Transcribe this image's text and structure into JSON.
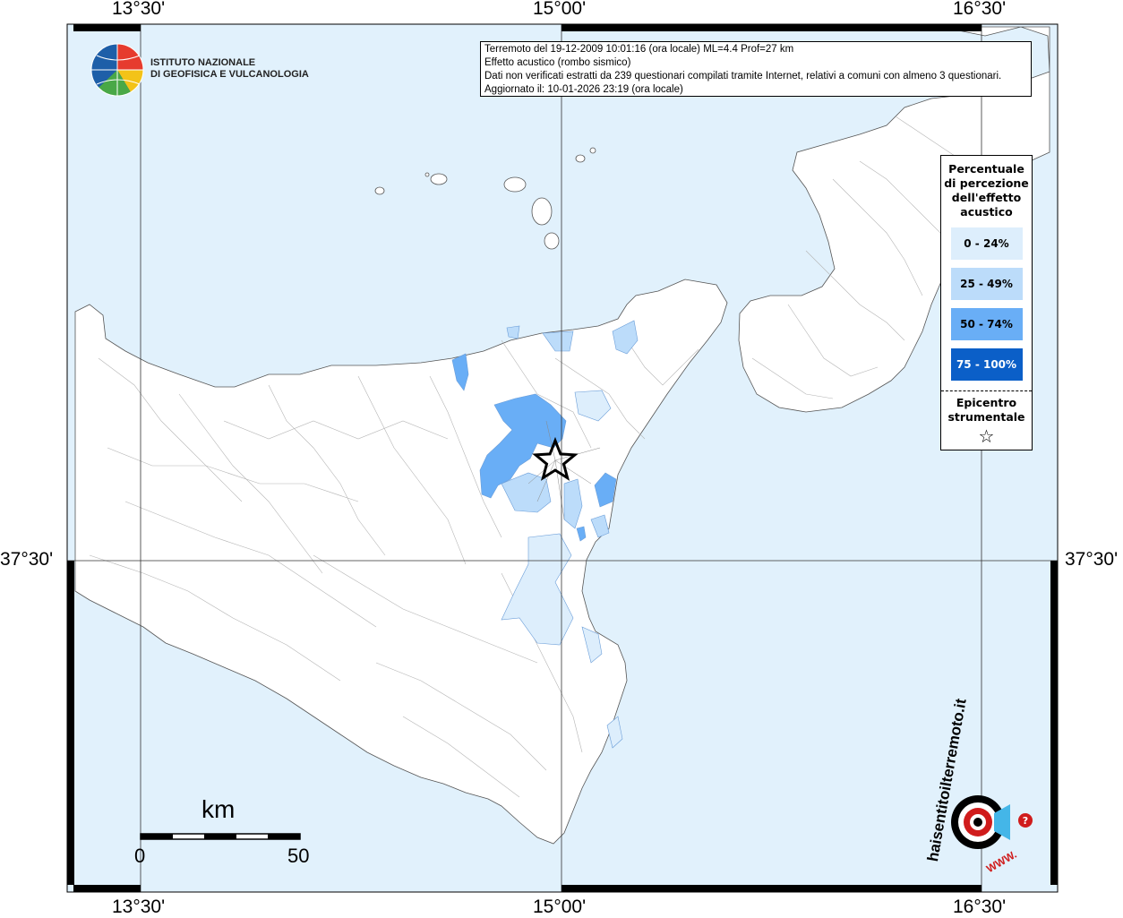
{
  "map": {
    "longitude_labels": [
      "13°30'",
      "15°00'",
      "16°30'"
    ],
    "latitude_labels": [
      "37°30'",
      "37°30'"
    ]
  },
  "info": {
    "line1": "Terremoto del 19-12-2009 10:01:16 (ora locale) ML=4.4 Prof=27 km",
    "line2": "Effetto acustico (rombo sismico)",
    "line3": "Dati non verificati estratti da 239 questionari compilati tramite Internet, relativi a comuni con almeno 3 questionari.",
    "line4": "Aggiornato il: 10-01-2026 23:19 (ora locale)"
  },
  "legend": {
    "title": "Percentuale di percezione dell'effetto acustico",
    "items": [
      {
        "label": "0 - 24%",
        "color": "#ddeefc"
      },
      {
        "label": "25 - 49%",
        "color": "#bcdcfa"
      },
      {
        "label": "50 - 74%",
        "color": "#69aef6"
      },
      {
        "label": "75 - 100%",
        "color": "#0b5fc8"
      }
    ],
    "epicenter_label": "Epicentro strumentale",
    "epicenter_symbol": "☆"
  },
  "logo": {
    "institute_line1": "ISTITUTO NAZIONALE",
    "institute_line2": "DI GEOFISICA E VULCANOLOGIA",
    "hsit_text": "haisentitoilterremoto.it",
    "hsit_url": "WWW."
  },
  "scale": {
    "unit": "km",
    "min": "0",
    "max": "50"
  },
  "colors": {
    "sea": "#e1f1fc",
    "land": "#ffffff",
    "frame": "#000000"
  }
}
